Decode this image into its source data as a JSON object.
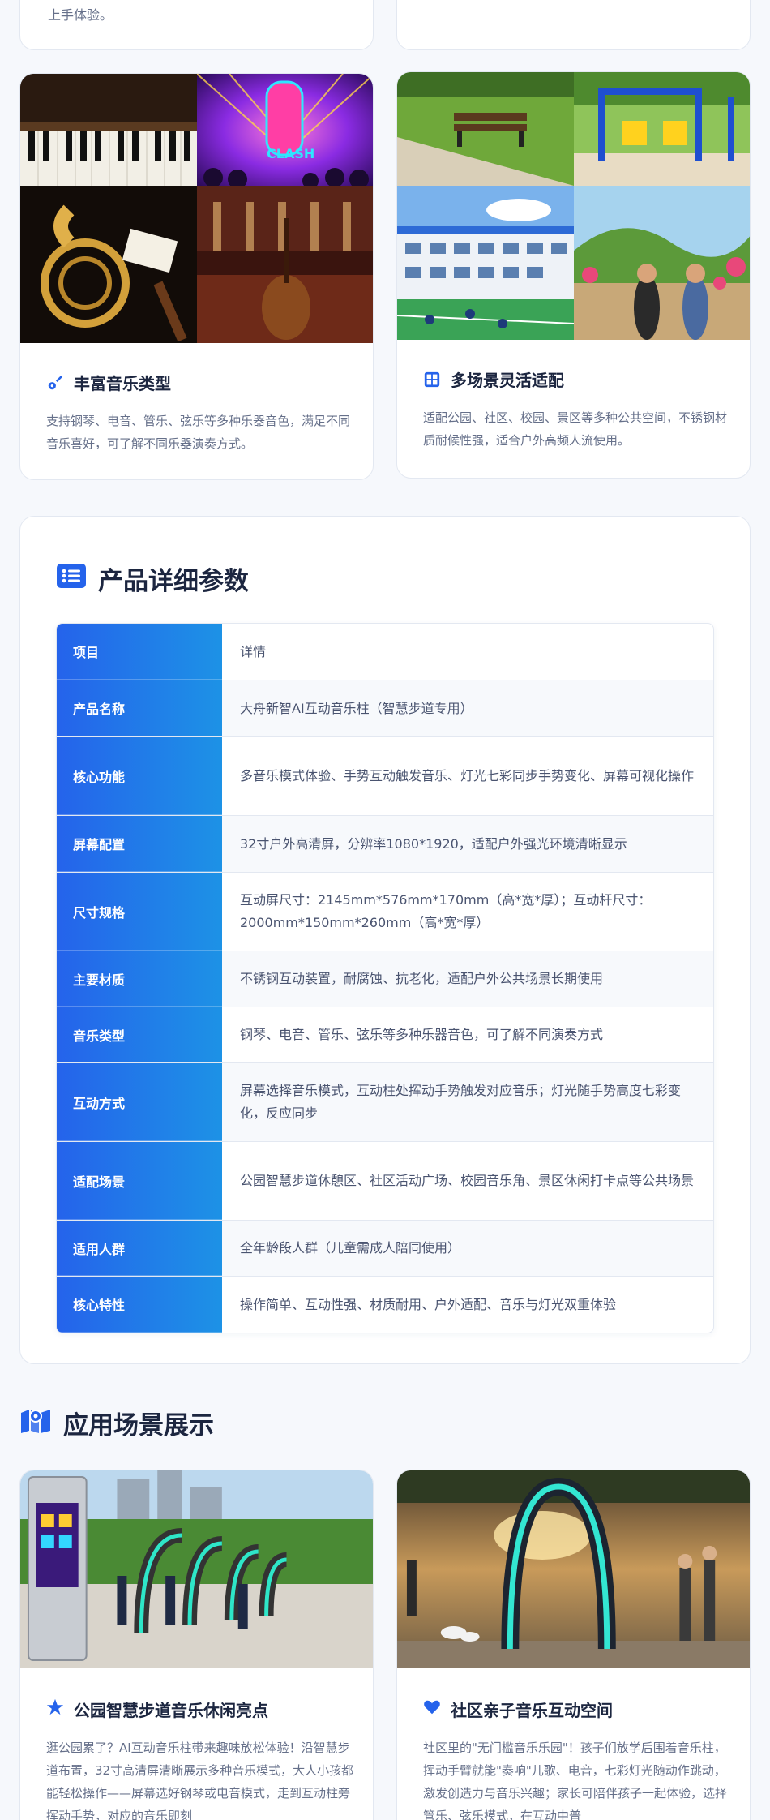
{
  "top_cards": {
    "left_text": "上手体验。"
  },
  "features": [
    {
      "title": "丰富音乐类型",
      "icon": "guitar-icon",
      "desc": "支持钢琴、电音、管乐、弦乐等多种乐器音色，满足不同音乐喜好，可了解不同乐器演奏方式。",
      "image_text": "CLASH"
    },
    {
      "title": "多场景灵活适配",
      "icon": "grid-icon",
      "desc": "适配公园、社区、校园、景区等多种公共空间，不锈钢材质耐候性强，适合户外高频人流使用。"
    }
  ],
  "params": {
    "title": "产品详细参数",
    "icon": "list-icon",
    "rows": [
      {
        "key": "项目",
        "value": "详情"
      },
      {
        "key": "产品名称",
        "value": "大舟新智AI互动音乐柱（智慧步道专用）"
      },
      {
        "key": "核心功能",
        "value": "多音乐模式体验、手势互动触发音乐、灯光七彩同步手势变化、屏幕可视化操作"
      },
      {
        "key": "屏幕配置",
        "value": "32寸户外高清屏，分辨率1080*1920，适配户外强光环境清晰显示"
      },
      {
        "key": "尺寸规格",
        "value": "互动屏尺寸：2145mm*576mm*170mm（高*宽*厚）；互动杆尺寸：2000mm*150mm*260mm（高*宽*厚）"
      },
      {
        "key": "主要材质",
        "value": "不锈钢互动装置，耐腐蚀、抗老化，适配户外公共场景长期使用"
      },
      {
        "key": "音乐类型",
        "value": "钢琴、电音、管乐、弦乐等多种乐器音色，可了解不同演奏方式"
      },
      {
        "key": "互动方式",
        "value": "屏幕选择音乐模式，互动柱处挥动手势触发对应音乐；灯光随手势高度七彩变化，反应同步"
      },
      {
        "key": "适配场景",
        "value": "公园智慧步道休憩区、社区活动广场、校园音乐角、景区休闲打卡点等公共场景"
      },
      {
        "key": "适用人群",
        "value": "全年龄段人群（儿童需成人陪同使用）"
      },
      {
        "key": "核心特性",
        "value": "操作简单、互动性强、材质耐用、户外适配、音乐与灯光双重体验"
      }
    ]
  },
  "scenes": {
    "title": "应用场景展示",
    "icon": "map-icon",
    "items": [
      {
        "title": "公园智慧步道音乐休闲亮点",
        "icon": "star-icon",
        "desc": "逛公园累了？AI互动音乐柱带来趣味放松体验！沿智慧步道布置，32寸高清屏清晰展示多种音乐模式，大人小孩都能轻松操作——屏幕选好钢琴或电音模式，走到互动柱旁挥动手势，对应的音乐即刻"
      },
      {
        "title": "社区亲子音乐互动空间",
        "icon": "heart-icon",
        "desc": "社区里的\"无门槛音乐乐园\"！孩子们放学后围着音乐柱，挥动手臂就能\"奏响\"儿歌、电音，七彩灯光随动作跳动，激发创造力与音乐兴趣；家长可陪伴孩子一起体验，选择管乐、弦乐模式，在互动中普"
      }
    ]
  },
  "colors": {
    "accent": "#2563eb",
    "accent2": "#1d92e6",
    "text": "#1c2640",
    "muted": "#66708a"
  }
}
